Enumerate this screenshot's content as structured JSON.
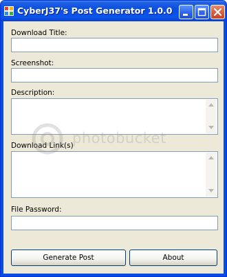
{
  "window": {
    "title": "CyberJ37's Post Generator 1.0.0"
  },
  "form": {
    "download_title_label": "Download Title:",
    "download_title_value": "",
    "screenshot_label": "Screenshot:",
    "screenshot_value": "",
    "description_label": "Description:",
    "description_value": "",
    "download_links_label": "Download Link(s)",
    "download_links_value": "",
    "file_password_label": "File Password:",
    "file_password_value": ""
  },
  "buttons": {
    "generate": "Generate Post",
    "about": "About"
  },
  "watermark": {
    "text": "photobucket"
  },
  "icons": [
    "app-icon",
    "minimize-icon",
    "maximize-icon",
    "close-icon",
    "scroll-up-icon",
    "scroll-down-icon"
  ],
  "colors": {
    "titlebar": "#0a4fe0",
    "client": "#ece9d8",
    "field_border": "#7f9db9",
    "close": "#d45a36"
  }
}
